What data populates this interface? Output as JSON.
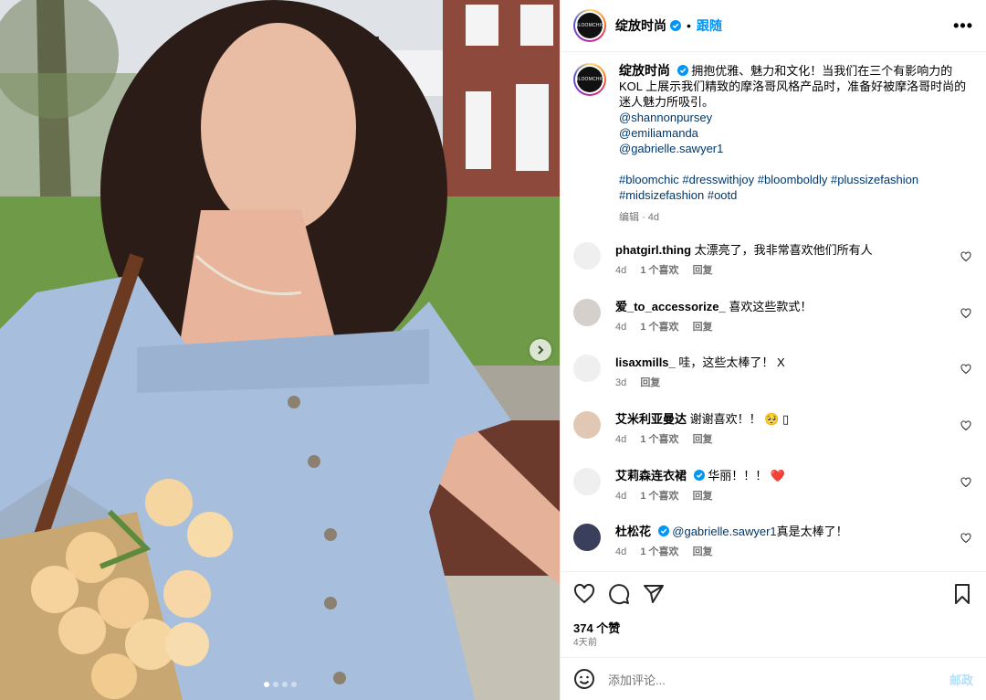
{
  "header": {
    "username": "绽放时尚",
    "separator": "•",
    "follow_label": "跟随",
    "more_label": "•••",
    "avatar_text": "BLOOMCHIC"
  },
  "caption": {
    "username": "绽放时尚",
    "text": "拥抱优雅、魅力和文化！当我们在三个有影响力的 KOL 上展示我们精致的摩洛哥风格产品时，准备好被摩洛哥时尚的迷人魅力所吸引。",
    "mentions": [
      "@shannonpursey",
      "@emiliamanda",
      "@gabrielle.sawyer1"
    ],
    "hashtags": [
      "#bloomchic",
      "#dresswithjoy",
      "#bloomboldly",
      "#plussizefashion",
      "#midsizefashion",
      "#ootd"
    ],
    "edited_label": "编辑",
    "time": "4d"
  },
  "comments": [
    {
      "user": "phatgirl.thing",
      "text": "太漂亮了，我非常喜欢他们所有人",
      "time": "4d",
      "likes": "1 个喜欢",
      "reply": "回复",
      "verified": false
    },
    {
      "user": "爱_to_accessorize_",
      "text": "喜欢这些款式！",
      "time": "4d",
      "likes": "1 个喜欢",
      "reply": "回复",
      "verified": false
    },
    {
      "user": "lisaxmills_",
      "text": "哇，这些太棒了！ X",
      "time": "3d",
      "likes": "",
      "reply": "回复",
      "verified": false
    },
    {
      "user": "艾米利亚曼达",
      "text": "谢谢喜欢！！ 🥺 ▯",
      "time": "4d",
      "likes": "1 个喜欢",
      "reply": "回复",
      "verified": false
    },
    {
      "user": "艾莉森连衣裙",
      "text": "华丽！！！ ❤️",
      "time": "4d",
      "likes": "1 个喜欢",
      "reply": "回复",
      "verified": true
    },
    {
      "user": "杜松花",
      "mention": "@gabrielle.sawyer1",
      "text": "真是太棒了！",
      "time": "4d",
      "likes": "1 个喜欢",
      "reply": "回复",
      "verified": true
    }
  ],
  "likes_label": "374 个赞",
  "posted_ago": "4天前",
  "add_comment": {
    "placeholder": "添加评论...",
    "post_label": "邮政"
  },
  "colors": {
    "accent": "#0095f6",
    "like_red": "#ed4956",
    "muted": "#737373"
  }
}
